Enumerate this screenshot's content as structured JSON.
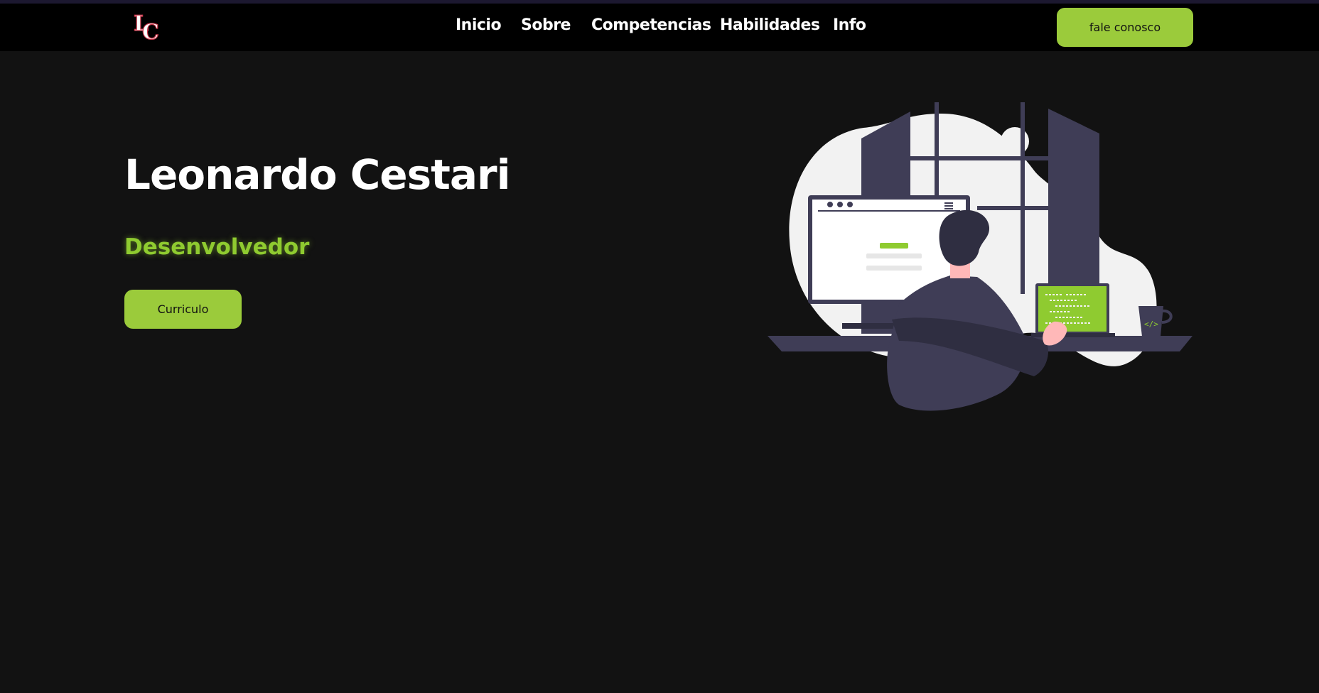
{
  "header": {
    "logo_text": "LC",
    "nav": [
      {
        "label": "Inicio"
      },
      {
        "label": "Sobre"
      },
      {
        "label": "Competencias"
      },
      {
        "label": "Habilidades"
      },
      {
        "label": "Info"
      }
    ],
    "cta_label": "fale conosco"
  },
  "hero": {
    "name": "Leonardo Cestari",
    "role": "Desenvolvedor",
    "button_label": "Curriculo"
  },
  "colors": {
    "background": "#121212",
    "navbar": "#000000",
    "accent": "#9bcb3b",
    "accent_text": "#8fcb30",
    "illustration_dark": "#3f3d56",
    "illustration_light": "#f2f2f2"
  },
  "icons": {
    "logo": "lc-monogram-icon",
    "illustration": "developer-at-desk-illustration"
  }
}
